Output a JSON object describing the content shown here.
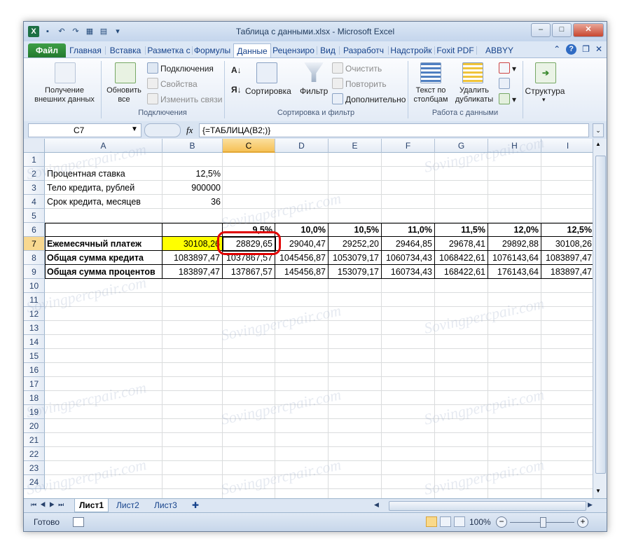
{
  "window": {
    "title": "Таблица с данными.xlsx - Microsoft Excel"
  },
  "ribbon_tabs": [
    "Файл",
    "Главная",
    "Вставка",
    "Разметка с",
    "Формулы",
    "Данные",
    "Рецензиро",
    "Вид",
    "Разработч",
    "Надстройк",
    "Foxit PDF",
    "ABBYY PDF"
  ],
  "ribbon": {
    "get_external": "Получение внешних данных",
    "refresh_all": "Обновить все",
    "connections": "Подключения",
    "properties": "Свойства",
    "edit_links": "Изменить связи",
    "group_connections": "Подключения",
    "sort": "Сортировка",
    "filter": "Фильтр",
    "clear": "Очистить",
    "reapply": "Повторить",
    "advanced": "Дополнительно",
    "group_sort_filter": "Сортировка и фильтр",
    "text_to_columns": "Текст по столбцам",
    "remove_duplicates": "Удалить дубликаты",
    "group_data_tools": "Работа с данными",
    "outline": "Структура"
  },
  "formula_bar": {
    "name_box": "C7",
    "fx": "fx",
    "formula": "{=ТАБЛИЦА(B2;)}"
  },
  "columns": [
    "A",
    "B",
    "C",
    "D",
    "E",
    "F",
    "G",
    "H",
    "I"
  ],
  "rows": [
    "1",
    "2",
    "3",
    "4",
    "5",
    "6",
    "7",
    "8",
    "9",
    "10",
    "11",
    "12",
    "13",
    "14",
    "15",
    "16",
    "17",
    "18",
    "19",
    "20",
    "21",
    "22",
    "23",
    "24"
  ],
  "cells": {
    "a2": "Процентная ставка",
    "b2": "12,5%",
    "a3": "Тело кредита, рублей",
    "b3": "900000",
    "a4": "Срок кредита, месяцев",
    "b4": "36",
    "row6": [
      "",
      "",
      "9,5%",
      "10,0%",
      "10,5%",
      "11,0%",
      "11,5%",
      "12,0%",
      "12,5%"
    ],
    "row7": [
      "Ежемесячный платеж",
      "30108,26",
      "28829,65",
      "29040,47",
      "29252,20",
      "29464,85",
      "29678,41",
      "29892,88",
      "30108,26"
    ],
    "row8": [
      "Общая сумма кредита",
      "1083897,47",
      "1037867,57",
      "1045456,87",
      "1053079,17",
      "1060734,43",
      "1068422,61",
      "1076143,64",
      "1083897,47"
    ],
    "row9": [
      "Общая сумма процентов",
      "183897,47",
      "137867,57",
      "145456,87",
      "153079,17",
      "160734,43",
      "168422,61",
      "176143,64",
      "183897,47"
    ]
  },
  "sheets": [
    "Лист1",
    "Лист2",
    "Лист3"
  ],
  "status": {
    "ready": "Готово",
    "zoom": "100%"
  },
  "watermark": "Sovingpercpair.com",
  "colors": {
    "highlight": "#ffff00",
    "callout": "#e00000",
    "file_tab": "#2e8b3a"
  }
}
